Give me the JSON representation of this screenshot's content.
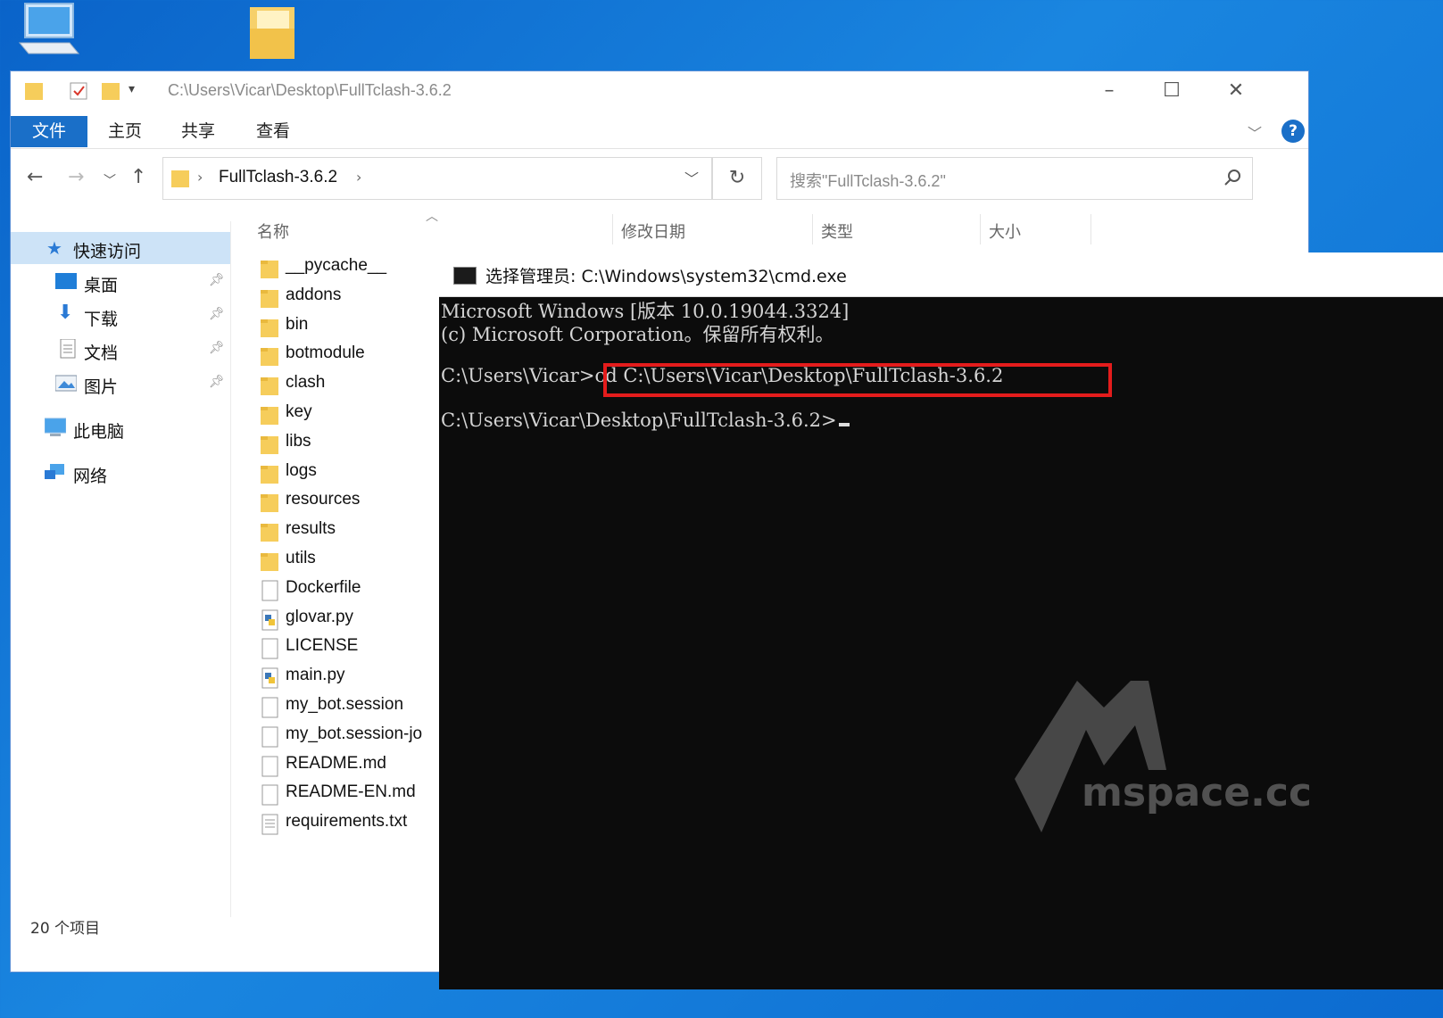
{
  "desktop": {
    "icons": [
      "this-pc-icon",
      "folder-icon"
    ]
  },
  "explorer": {
    "title_path": "C:\\Users\\Vicar\\Desktop\\FullTclash-3.6.2",
    "ribbon_tabs": [
      "文件",
      "主页",
      "共享",
      "查看"
    ],
    "breadcrumb": "FullTclash-3.6.2",
    "search_placeholder": "搜索\"FullTclash-3.6.2\"",
    "columns": [
      "名称",
      "修改日期",
      "类型",
      "大小"
    ],
    "nav_items": [
      {
        "label": "快速访问",
        "icon": "star-icon"
      },
      {
        "label": "桌面",
        "icon": "desktop-icon"
      },
      {
        "label": "下载",
        "icon": "download-icon"
      },
      {
        "label": "文档",
        "icon": "document-icon"
      },
      {
        "label": "图片",
        "icon": "pictures-icon"
      },
      {
        "label": "此电脑",
        "icon": "this-pc-icon"
      },
      {
        "label": "网络",
        "icon": "network-icon"
      }
    ],
    "files": [
      {
        "name": "__pycache__",
        "kind": "folder"
      },
      {
        "name": "addons",
        "kind": "folder"
      },
      {
        "name": "bin",
        "kind": "folder"
      },
      {
        "name": "botmodule",
        "kind": "folder"
      },
      {
        "name": "clash",
        "kind": "folder"
      },
      {
        "name": "key",
        "kind": "folder"
      },
      {
        "name": "libs",
        "kind": "folder"
      },
      {
        "name": "logs",
        "kind": "folder"
      },
      {
        "name": "resources",
        "kind": "folder"
      },
      {
        "name": "results",
        "kind": "folder"
      },
      {
        "name": "utils",
        "kind": "folder"
      },
      {
        "name": "Dockerfile",
        "kind": "file"
      },
      {
        "name": "glovar.py",
        "kind": "python"
      },
      {
        "name": "LICENSE",
        "kind": "file"
      },
      {
        "name": "main.py",
        "kind": "python"
      },
      {
        "name": "my_bot.session",
        "kind": "file"
      },
      {
        "name": "my_bot.session-jo",
        "kind": "file"
      },
      {
        "name": "README.md",
        "kind": "file"
      },
      {
        "name": "README-EN.md",
        "kind": "file"
      },
      {
        "name": "requirements.txt",
        "kind": "text"
      }
    ],
    "status": "20 个项目"
  },
  "cmd": {
    "title": "选择管理员: C:\\Windows\\system32\\cmd.exe",
    "lines": [
      "Microsoft Windows [版本 10.0.19044.3324]",
      "(c) Microsoft Corporation。保留所有权利。",
      "C:\\Users\\Vicar>cd C:\\Users\\Vicar\\Desktop\\FullTclash-3.6.2",
      "C:\\Users\\Vicar\\Desktop\\FullTclash-3.6.2>"
    ],
    "highlight_color": "#e41c1c"
  },
  "watermark": "mspace.cc",
  "colors": {
    "accent": "#1a6fc8",
    "desktop": "#0a63c9",
    "terminal_bg": "#0c0c0c"
  }
}
